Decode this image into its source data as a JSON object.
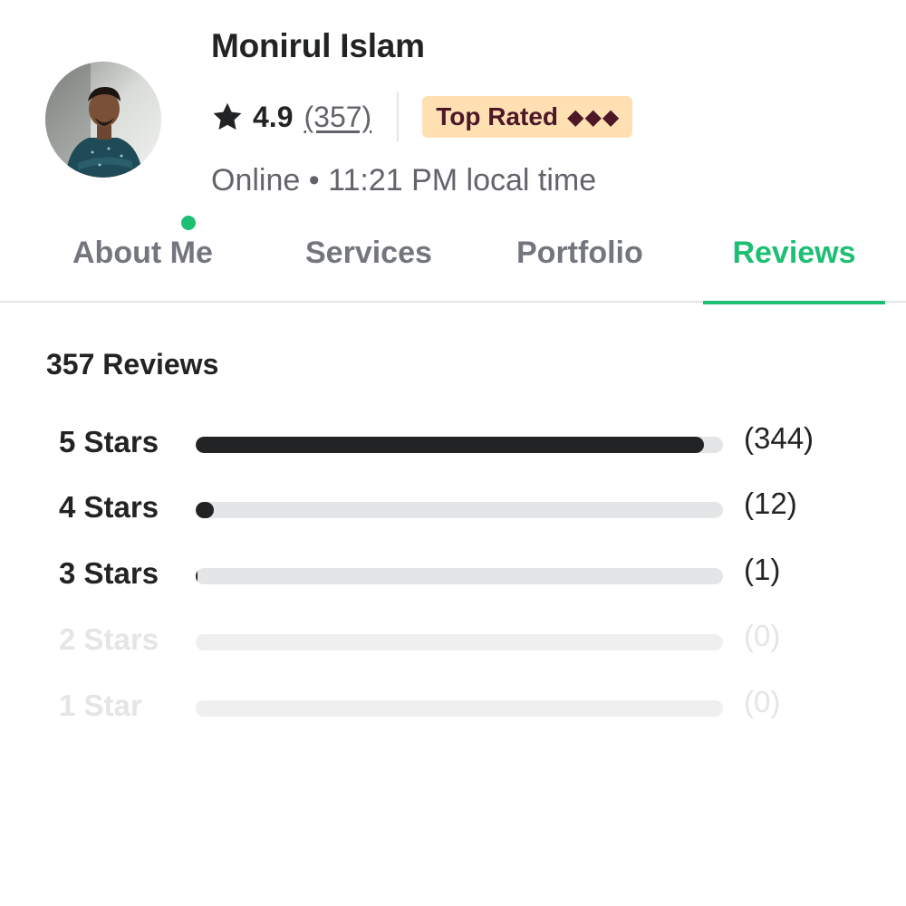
{
  "profile": {
    "name": "Monirul Islam",
    "rating": "4.9",
    "rating_count": "(357)",
    "badge_label": "Top Rated",
    "badge_diamonds": "◆◆◆",
    "status": "Online • 11:21 PM local time",
    "online": true,
    "icons": [
      "star-icon",
      "diamond-icon",
      "online-dot"
    ]
  },
  "tabs": [
    {
      "label": "About Me",
      "active": false
    },
    {
      "label": "Services",
      "active": false
    },
    {
      "label": "Portfolio",
      "active": false
    },
    {
      "label": "Reviews",
      "active": true
    }
  ],
  "reviews": {
    "title": "357 Reviews",
    "breakdown": [
      {
        "label": "5 Stars",
        "count": "(344)",
        "fraction": 0.964,
        "enabled": true
      },
      {
        "label": "4 Stars",
        "count": "(12)",
        "fraction": 0.034,
        "enabled": true
      },
      {
        "label": "3 Stars",
        "count": "(1)",
        "fraction": 0.003,
        "enabled": true
      },
      {
        "label": "2 Stars",
        "count": "(0)",
        "fraction": 0,
        "enabled": false
      },
      {
        "label": "1 Star",
        "count": "(0)",
        "fraction": 0,
        "enabled": false
      }
    ]
  },
  "colors": {
    "accent": "#1dbf73",
    "text": "#222325",
    "muted": "#62646a",
    "badge_bg": "#ffe0b3",
    "badge_text": "#4d1727",
    "bar_fill": "#222325",
    "bar_track": "#e4e5e7"
  }
}
